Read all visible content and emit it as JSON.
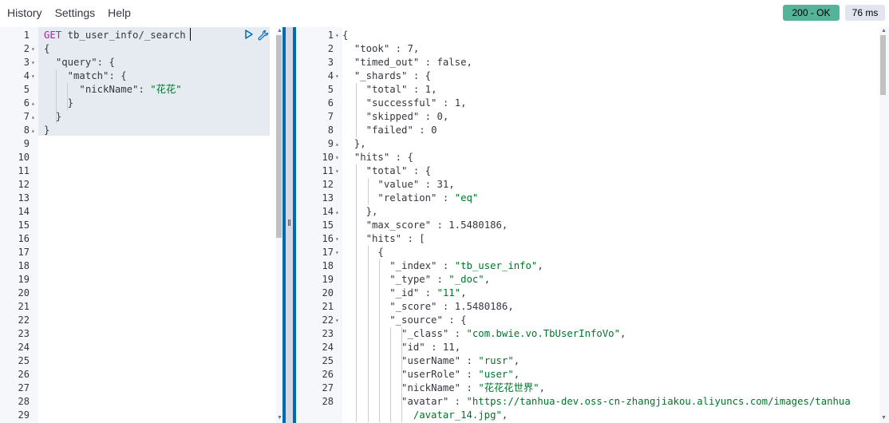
{
  "menu": {
    "history": "History",
    "settings": "Settings",
    "help": "Help"
  },
  "status": {
    "code": "200 - OK",
    "time": "76 ms",
    "color": "#54b399"
  },
  "request": {
    "method": "GET",
    "path": "tb_user_info/_search",
    "lines": [
      {
        "n": "1",
        "fold": "",
        "text": ""
      },
      {
        "n": "2",
        "fold": "▾",
        "text": "{"
      },
      {
        "n": "3",
        "fold": "▾",
        "text": "  \"query\": {"
      },
      {
        "n": "4",
        "fold": "▾",
        "text": "    \"match\": {"
      },
      {
        "n": "5",
        "fold": "",
        "text": "      \"nickName\": \"花花\""
      },
      {
        "n": "6",
        "fold": "▴",
        "text": "    }"
      },
      {
        "n": "7",
        "fold": "▴",
        "text": "  }"
      },
      {
        "n": "8",
        "fold": "▴",
        "text": "}"
      }
    ],
    "empty_lines": [
      "9",
      "10",
      "11",
      "12",
      "13",
      "14",
      "15",
      "16",
      "17",
      "18",
      "19",
      "20",
      "21",
      "22",
      "23",
      "24",
      "25",
      "26",
      "27",
      "28",
      "29"
    ]
  },
  "response": {
    "lines": [
      {
        "n": "1",
        "fold": "▾",
        "text": "{"
      },
      {
        "n": "2",
        "fold": "",
        "text": "  \"took\" : 7,"
      },
      {
        "n": "3",
        "fold": "",
        "text": "  \"timed_out\" : false,"
      },
      {
        "n": "4",
        "fold": "▾",
        "text": "  \"_shards\" : {"
      },
      {
        "n": "5",
        "fold": "",
        "text": "    \"total\" : 1,"
      },
      {
        "n": "6",
        "fold": "",
        "text": "    \"successful\" : 1,"
      },
      {
        "n": "7",
        "fold": "",
        "text": "    \"skipped\" : 0,"
      },
      {
        "n": "8",
        "fold": "",
        "text": "    \"failed\" : 0"
      },
      {
        "n": "9",
        "fold": "▴",
        "text": "  },"
      },
      {
        "n": "10",
        "fold": "▾",
        "text": "  \"hits\" : {"
      },
      {
        "n": "11",
        "fold": "▾",
        "text": "    \"total\" : {"
      },
      {
        "n": "12",
        "fold": "",
        "text": "      \"value\" : 31,"
      },
      {
        "n": "13",
        "fold": "",
        "text": "      \"relation\" : \"eq\""
      },
      {
        "n": "14",
        "fold": "▴",
        "text": "    },"
      },
      {
        "n": "15",
        "fold": "",
        "text": "    \"max_score\" : 1.5480186,"
      },
      {
        "n": "16",
        "fold": "▾",
        "text": "    \"hits\" : ["
      },
      {
        "n": "17",
        "fold": "▾",
        "text": "      {"
      },
      {
        "n": "18",
        "fold": "",
        "text": "        \"_index\" : \"tb_user_info\","
      },
      {
        "n": "19",
        "fold": "",
        "text": "        \"_type\" : \"_doc\","
      },
      {
        "n": "20",
        "fold": "",
        "text": "        \"_id\" : \"11\","
      },
      {
        "n": "21",
        "fold": "",
        "text": "        \"_score\" : 1.5480186,"
      },
      {
        "n": "22",
        "fold": "▾",
        "text": "        \"_source\" : {"
      },
      {
        "n": "23",
        "fold": "",
        "text": "          \"_class\" : \"com.bwie.vo.TbUserInfoVo\","
      },
      {
        "n": "24",
        "fold": "",
        "text": "          \"id\" : 11,"
      },
      {
        "n": "25",
        "fold": "",
        "text": "          \"userName\" : \"rusr\","
      },
      {
        "n": "26",
        "fold": "",
        "text": "          \"userRole\" : \"user\","
      },
      {
        "n": "27",
        "fold": "",
        "text": "          \"nickName\" : \"花花花世界\","
      },
      {
        "n": "28",
        "fold": "",
        "text": "          \"avatar\" : \"https://tanhua-dev.oss-cn-zhangjiakou.aliyuncs.com/images/tanhua"
      },
      {
        "n": "",
        "fold": "",
        "text": "            /avatar_14.jpg\","
      }
    ]
  }
}
